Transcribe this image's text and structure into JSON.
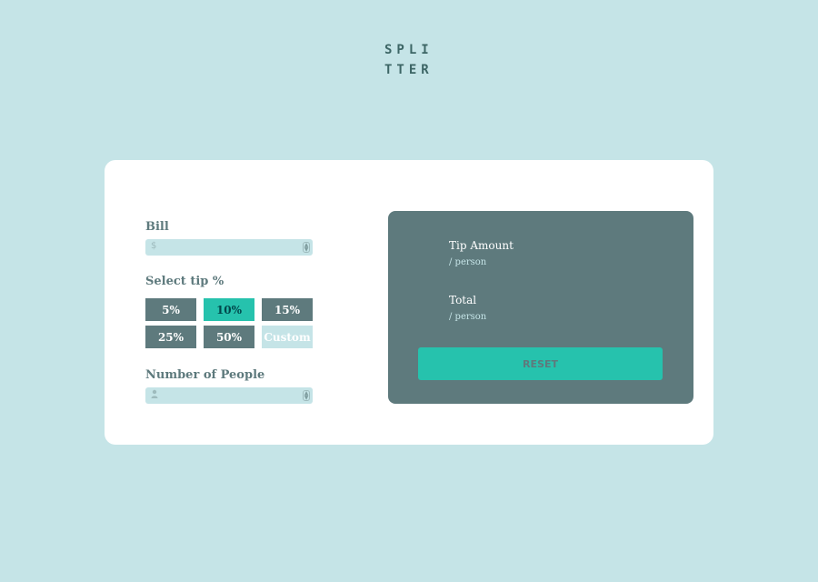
{
  "logo": {
    "line1": "SPLI",
    "line2": "TTER"
  },
  "bill": {
    "label": "Bill",
    "icon": "$"
  },
  "tip": {
    "label": "Select tip %",
    "options": [
      "5%",
      "10%",
      "15%",
      "25%",
      "50%"
    ],
    "selected": "10%",
    "custom_label": "Custom"
  },
  "people": {
    "label": "Number of People",
    "icon": "person-icon"
  },
  "results": {
    "tip_amount_label": "Tip Amount",
    "total_label": "Total",
    "per_person": "/ person",
    "reset_label": "RESET"
  },
  "colors": {
    "background": "#c5e4e7",
    "card": "#ffffff",
    "panel": "#5e7a7d",
    "accent": "#26c2ad",
    "dark_text": "#00474b"
  }
}
